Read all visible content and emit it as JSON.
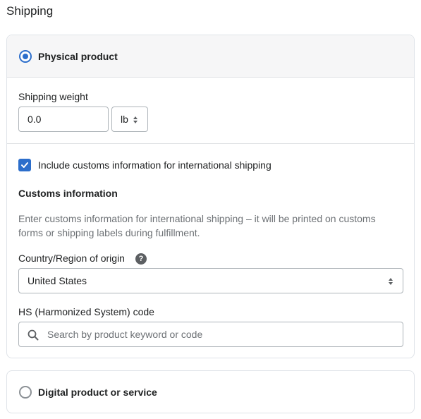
{
  "section_title": "Shipping",
  "physical": {
    "label": "Physical product",
    "selected": true,
    "weight_label": "Shipping weight",
    "weight_value": "0.0",
    "weight_unit": "lb"
  },
  "customs": {
    "checkbox_label": "Include customs information for international shipping",
    "checked": true,
    "heading": "Customs information",
    "help_line1": "Enter customs information for international shipping – it will be printed on customs",
    "help_line2": "forms or shipping labels during fulfillment.",
    "origin_label": "Country/Region of origin",
    "origin_value": "United States",
    "hs_label": "HS (Harmonized System) code",
    "hs_placeholder": "Search by product keyword or code"
  },
  "digital": {
    "label": "Digital product or service",
    "selected": false
  },
  "icons": {
    "help": "question-circle-icon",
    "search": "search-icon",
    "check": "checkmark-icon",
    "select": "select-arrows-icon"
  },
  "colors": {
    "accent": "#2c6ecb",
    "border": "#dfe3e8",
    "header_bg": "#f6f6f7",
    "muted_text": "#6d7175"
  }
}
